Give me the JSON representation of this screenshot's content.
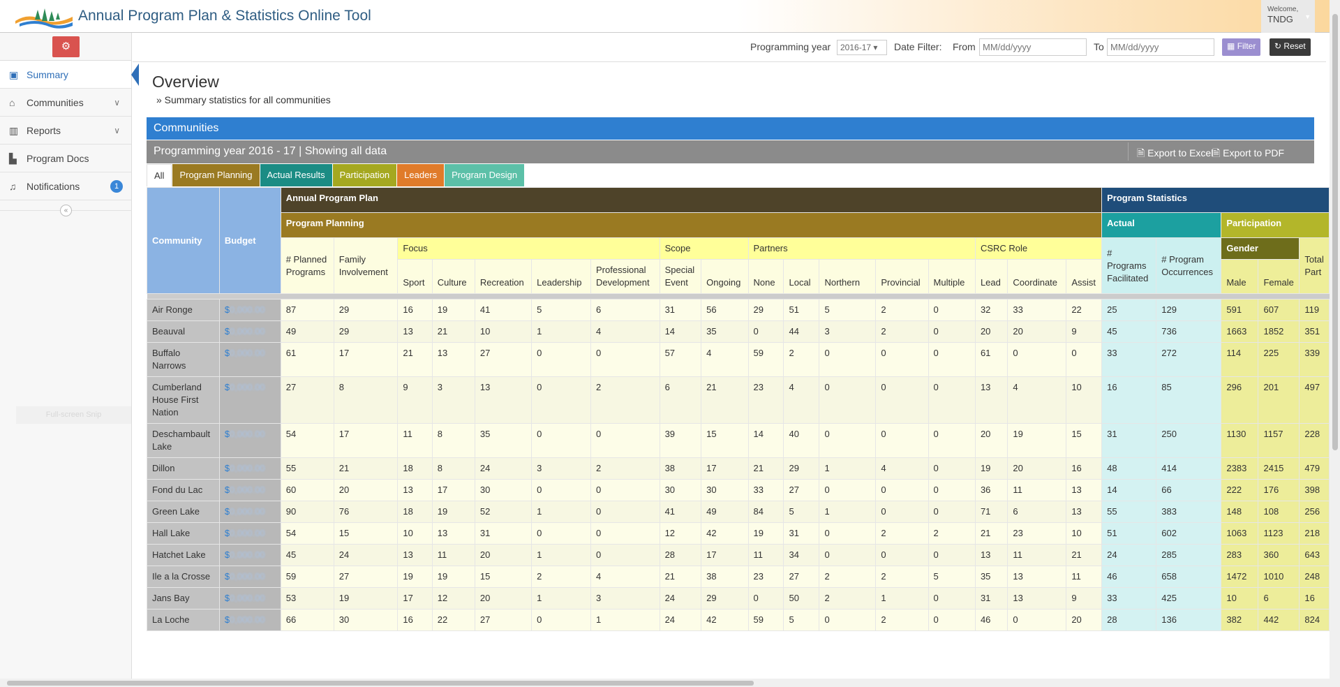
{
  "app": {
    "title": "Annual Program Plan & Statistics Online Tool",
    "welcome": "Welcome,",
    "user": "TNDG"
  },
  "sidebar": {
    "items": [
      {
        "label": "Summary",
        "icon": "picture-icon"
      },
      {
        "label": "Communities",
        "icon": "home-icon"
      },
      {
        "label": "Reports",
        "icon": "bar-chart-icon"
      },
      {
        "label": "Program Docs",
        "icon": "document-icon"
      },
      {
        "label": "Notifications",
        "icon": "bell-icon",
        "badge": "1"
      }
    ],
    "ghost": "Full-screen Snip"
  },
  "filter": {
    "year_label": "Programming year",
    "year_value": "2016-17",
    "date_label": "Date Filter:",
    "from_label": "From",
    "from_placeholder": "MM/dd/yyyy",
    "to_label": "To",
    "to_placeholder": "MM/dd/yyyy",
    "filter_btn": "Filter",
    "reset_btn": "Reset"
  },
  "page": {
    "title": "Overview",
    "subtitle": "» Summary statistics for all communities"
  },
  "panel": {
    "title": "Communities",
    "info": "Programming year 2016 - 17 | Showing all data",
    "export_excel": "Export to Excel",
    "export_pdf": "Export to PDF"
  },
  "tabs": [
    "All",
    "Program Planning",
    "Actual Results",
    "Participation",
    "Leaders",
    "Program Design"
  ],
  "table": {
    "groups": {
      "annual": "Annual Program Plan",
      "stats": "Program Statistics",
      "planning": "Program Planning",
      "actual": "Actual",
      "participation": "Participation",
      "focus": "Focus",
      "scope": "Scope",
      "partners": "Partners",
      "csrc": "CSRC Role",
      "gender": "Gender",
      "community": "Community",
      "budget": "Budget"
    },
    "cols": {
      "planned": "# Planned Programs",
      "family": "Family Involvement",
      "sport": "Sport",
      "culture": "Culture",
      "recreation": "Recreation",
      "leadership": "Leadership",
      "profdev": "Professional Development",
      "special": "Special Event",
      "ongoing": "Ongoing",
      "none": "None",
      "local": "Local",
      "northern": "Northern",
      "provincial": "Provincial",
      "multiple": "Multiple",
      "lead": "Lead",
      "coordinate": "Coordinate",
      "assist": "Assist",
      "facilitated": "# Programs Facilitated",
      "occurrences": "# Program Occurrences",
      "male": "Male",
      "female": "Female",
      "total": "Total Part"
    },
    "rows": [
      {
        "c": "Air Ronge",
        "b": "$",
        "v": [
          "87",
          "29",
          "16",
          "19",
          "41",
          "5",
          "6",
          "31",
          "56",
          "29",
          "51",
          "5",
          "2",
          "0",
          "32",
          "33",
          "22",
          "25",
          "129",
          "591",
          "607",
          "119"
        ]
      },
      {
        "c": "Beauval",
        "b": "$",
        "v": [
          "49",
          "29",
          "13",
          "21",
          "10",
          "1",
          "4",
          "14",
          "35",
          "0",
          "44",
          "3",
          "2",
          "0",
          "20",
          "20",
          "9",
          "45",
          "736",
          "1663",
          "1852",
          "351"
        ]
      },
      {
        "c": "Buffalo Narrows",
        "b": "$",
        "v": [
          "61",
          "17",
          "21",
          "13",
          "27",
          "0",
          "0",
          "57",
          "4",
          "59",
          "2",
          "0",
          "0",
          "0",
          "61",
          "0",
          "0",
          "33",
          "272",
          "114",
          "225",
          "339"
        ]
      },
      {
        "c": "Cumberland House First Nation",
        "b": "$",
        "v": [
          "27",
          "8",
          "9",
          "3",
          "13",
          "0",
          "2",
          "6",
          "21",
          "23",
          "4",
          "0",
          "0",
          "0",
          "13",
          "4",
          "10",
          "16",
          "85",
          "296",
          "201",
          "497"
        ]
      },
      {
        "c": "Deschambault Lake",
        "b": "$",
        "v": [
          "54",
          "17",
          "11",
          "8",
          "35",
          "0",
          "0",
          "39",
          "15",
          "14",
          "40",
          "0",
          "0",
          "0",
          "20",
          "19",
          "15",
          "31",
          "250",
          "1130",
          "1157",
          "228"
        ]
      },
      {
        "c": "Dillon",
        "b": "$",
        "v": [
          "55",
          "21",
          "18",
          "8",
          "24",
          "3",
          "2",
          "38",
          "17",
          "21",
          "29",
          "1",
          "4",
          "0",
          "19",
          "20",
          "16",
          "48",
          "414",
          "2383",
          "2415",
          "479"
        ]
      },
      {
        "c": "Fond du Lac",
        "b": "$",
        "v": [
          "60",
          "20",
          "13",
          "17",
          "30",
          "0",
          "0",
          "30",
          "30",
          "33",
          "27",
          "0",
          "0",
          "0",
          "36",
          "11",
          "13",
          "14",
          "66",
          "222",
          "176",
          "398"
        ]
      },
      {
        "c": "Green Lake",
        "b": "$",
        "v": [
          "90",
          "76",
          "18",
          "19",
          "52",
          "1",
          "0",
          "41",
          "49",
          "84",
          "5",
          "1",
          "0",
          "0",
          "71",
          "6",
          "13",
          "55",
          "383",
          "148",
          "108",
          "256"
        ]
      },
      {
        "c": "Hall Lake",
        "b": "$",
        "v": [
          "54",
          "15",
          "10",
          "13",
          "31",
          "0",
          "0",
          "12",
          "42",
          "19",
          "31",
          "0",
          "2",
          "2",
          "21",
          "23",
          "10",
          "51",
          "602",
          "1063",
          "1123",
          "218"
        ]
      },
      {
        "c": "Hatchet Lake",
        "b": "$",
        "v": [
          "45",
          "24",
          "13",
          "11",
          "20",
          "1",
          "0",
          "28",
          "17",
          "11",
          "34",
          "0",
          "0",
          "0",
          "13",
          "11",
          "21",
          "24",
          "285",
          "283",
          "360",
          "643"
        ]
      },
      {
        "c": "Ile a la Crosse",
        "b": "$",
        "v": [
          "59",
          "27",
          "19",
          "19",
          "15",
          "2",
          "4",
          "21",
          "38",
          "23",
          "27",
          "2",
          "2",
          "5",
          "35",
          "13",
          "11",
          "46",
          "658",
          "1472",
          "1010",
          "248"
        ]
      },
      {
        "c": "Jans Bay",
        "b": "$",
        "v": [
          "53",
          "19",
          "17",
          "12",
          "20",
          "1",
          "3",
          "24",
          "29",
          "0",
          "50",
          "2",
          "1",
          "0",
          "31",
          "13",
          "9",
          "33",
          "425",
          "10",
          "6",
          "16"
        ]
      },
      {
        "c": "La Loche",
        "b": "$",
        "v": [
          "66",
          "30",
          "16",
          "22",
          "27",
          "0",
          "1",
          "24",
          "42",
          "59",
          "5",
          "0",
          "2",
          "0",
          "46",
          "0",
          "20",
          "28",
          "136",
          "382",
          "442",
          "824"
        ]
      }
    ]
  },
  "colors": {
    "accent": "#2f7fd0",
    "danger": "#d9534f"
  }
}
